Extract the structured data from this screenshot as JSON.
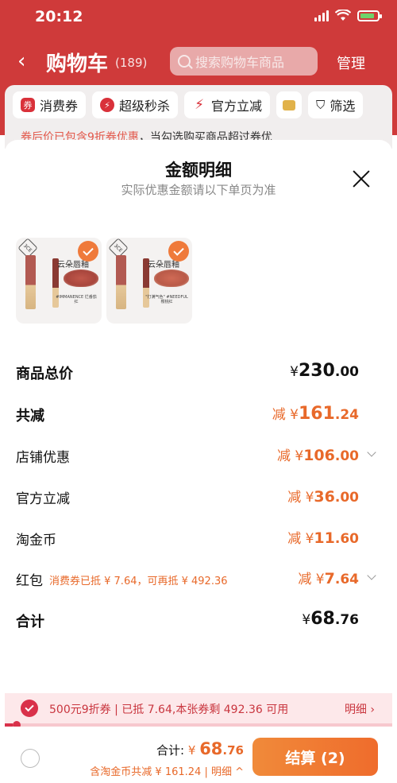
{
  "status_bar": {
    "time": "20:12"
  },
  "header": {
    "title": "购物车",
    "count": "(189)",
    "search_placeholder": "搜索购物车商品",
    "manage": "管理"
  },
  "filters": [
    {
      "icon": "coupon-icon",
      "label": "消费券"
    },
    {
      "icon": "flash-sale-icon",
      "label": "超级秒杀"
    },
    {
      "icon": "bolt-icon",
      "label": "官方立减"
    },
    {
      "icon": "folder-icon",
      "label": ""
    },
    {
      "icon": "filter-icon",
      "label": "筛选"
    }
  ],
  "coupon_strip": {
    "highlight": "券后价已包含9折券优惠",
    "rest": "，当勾选购买商品超过券优"
  },
  "sheet": {
    "title": "金额明细",
    "subtitle": "实际优惠金额请以下单页为准",
    "products": [
      {
        "name": "云朵唇釉",
        "caption": "#IMMANENCE 烂番茄红"
      },
      {
        "name": "云朵唇釉",
        "caption": "\"打满气色\" #NEEDFUL 樱桃红"
      }
    ],
    "rows": [
      {
        "key": "total_price",
        "label": "商品总价",
        "prefix": "¥",
        "int": "230",
        "dec": ".00"
      },
      {
        "key": "total_discount",
        "label": "共减",
        "prefix": "减 ¥",
        "int": "161",
        "dec": ".24"
      },
      {
        "key": "shop_discount",
        "label": "店铺优惠",
        "prefix": "减 ¥",
        "int": "106",
        "dec": ".00"
      },
      {
        "key": "official_discount",
        "label": "官方立减",
        "prefix": "减 ¥",
        "int": "36",
        "dec": ".00"
      },
      {
        "key": "gold_coins",
        "label": "淘金币",
        "prefix": "减 ¥",
        "int": "11",
        "dec": ".60"
      },
      {
        "key": "red_packet",
        "label": "红包",
        "note": "消费券已抵 ¥ 7.64，可再抵 ¥ 492.36",
        "prefix": "减 ¥",
        "int": "7",
        "dec": ".64"
      },
      {
        "key": "sum",
        "label": "合计",
        "prefix": "¥",
        "int": "68",
        "dec": ".76"
      }
    ]
  },
  "coupon_bar": {
    "text": "500元9折券 | 已抵 7.64,本张券剩 492.36 可用",
    "detail": "明细 ›",
    "progress": 0.02
  },
  "footer": {
    "total_label": "合计:",
    "total_prefix": "¥",
    "total_int": "68",
    "total_dec": ".76",
    "saved": "含淘金币共减 ¥ 161.24 | 明细 ^",
    "checkout": "结算 (2)"
  },
  "colors": {
    "accent": "#e8692a",
    "header_red": "#cf3a3a",
    "coupon_red": "#d9314a"
  }
}
